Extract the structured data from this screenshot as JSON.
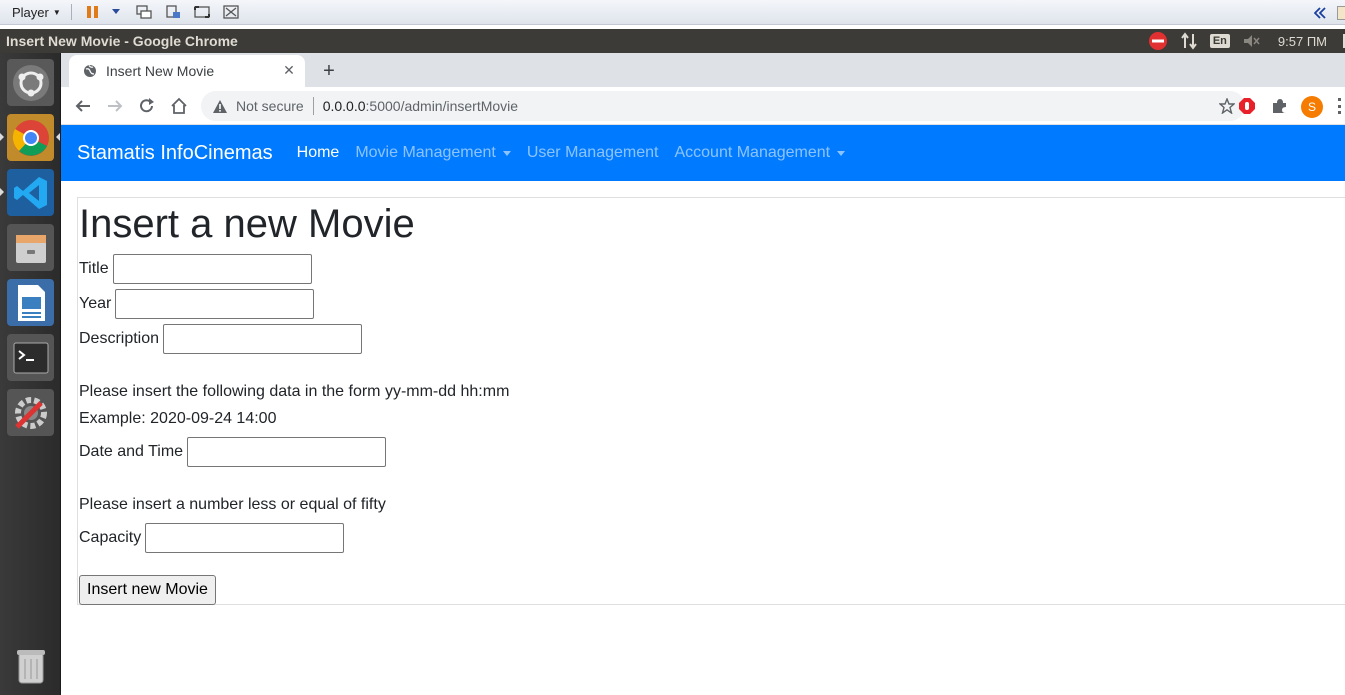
{
  "player_bar": {
    "menu_label": "Player"
  },
  "os_top_bar": {
    "window_title": "Insert New Movie - Google Chrome",
    "keyboard_layout": "En",
    "clock": "9:57 ПМ"
  },
  "browser": {
    "tab_title": "Insert New Movie",
    "security_label": "Not secure",
    "url_host": "0.0.0.0",
    "url_rest": ":5000/admin/insertMovie",
    "profile_initial": "S"
  },
  "navbar": {
    "brand": "Stamatis InfoCinemas",
    "links": [
      "Home",
      "Movie Management",
      "User Management",
      "Account Management"
    ]
  },
  "form": {
    "heading": "Insert a new Movie",
    "title_label": "Title",
    "year_label": "Year",
    "description_label": "Description",
    "date_note": "Please insert the following data in the form yy-mm-dd hh:mm",
    "date_example": "Example: 2020-09-24 14:00",
    "datetime_label": "Date and Time",
    "capacity_note": "Please insert a number less or equal of fifty",
    "capacity_label": "Capacity",
    "title_value": "",
    "year_value": "",
    "description_value": "",
    "datetime_value": "",
    "capacity_value": "",
    "submit_label": "Insert new Movie"
  },
  "colors": {
    "navbar_bg": "#007bff",
    "os_bar_bg": "#3c3b37",
    "profile_avatar": "#f57c00"
  }
}
